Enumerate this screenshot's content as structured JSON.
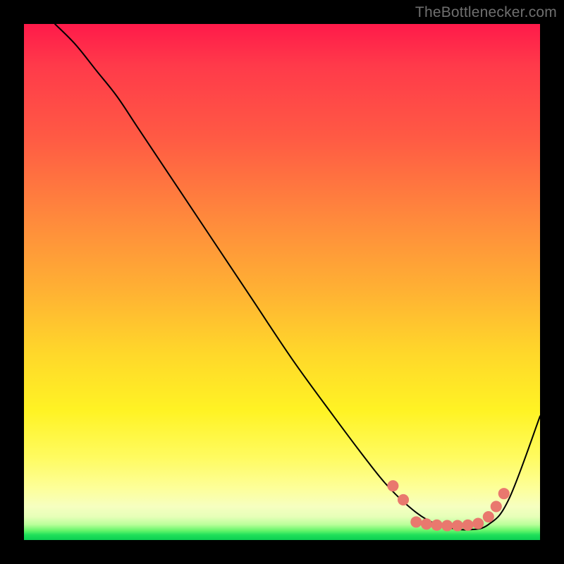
{
  "watermark": "TheBottlenecker.com",
  "chart_data": {
    "type": "line",
    "title": "",
    "xlabel": "",
    "ylabel": "",
    "xlim": [
      0,
      100
    ],
    "ylim": [
      0,
      100
    ],
    "grid": false,
    "legend": false,
    "series": [
      {
        "name": "bottleneck-curve",
        "color": "#000000",
        "x": [
          6,
          10,
          14,
          18,
          22,
          28,
          36,
          44,
          52,
          60,
          66,
          70,
          74,
          78,
          82,
          86,
          90,
          94,
          100
        ],
        "y": [
          100,
          96,
          91,
          86,
          80,
          71,
          59,
          47,
          35,
          24,
          16,
          11,
          7,
          4,
          2.5,
          2,
          3,
          8,
          24
        ]
      }
    ],
    "highlight_dots": {
      "name": "optimal-range-dots",
      "color": "#e9786e",
      "radius_pct": 1.1,
      "points": [
        {
          "x": 71.5,
          "y": 10.5
        },
        {
          "x": 73.5,
          "y": 7.8
        },
        {
          "x": 76.0,
          "y": 3.5
        },
        {
          "x": 78.0,
          "y": 3.1
        },
        {
          "x": 80.0,
          "y": 2.9
        },
        {
          "x": 82.0,
          "y": 2.8
        },
        {
          "x": 84.0,
          "y": 2.8
        },
        {
          "x": 86.0,
          "y": 2.9
        },
        {
          "x": 88.0,
          "y": 3.2
        },
        {
          "x": 90.0,
          "y": 4.5
        },
        {
          "x": 91.5,
          "y": 6.5
        },
        {
          "x": 93.0,
          "y": 9.0
        }
      ]
    },
    "background": {
      "type": "vertical-gradient",
      "stops": [
        {
          "pos": 0.0,
          "color": "#ff1a4a"
        },
        {
          "pos": 0.5,
          "color": "#ffb233"
        },
        {
          "pos": 0.8,
          "color": "#fffb60"
        },
        {
          "pos": 0.97,
          "color": "#baff9a"
        },
        {
          "pos": 1.0,
          "color": "#0bcf53"
        }
      ]
    }
  }
}
